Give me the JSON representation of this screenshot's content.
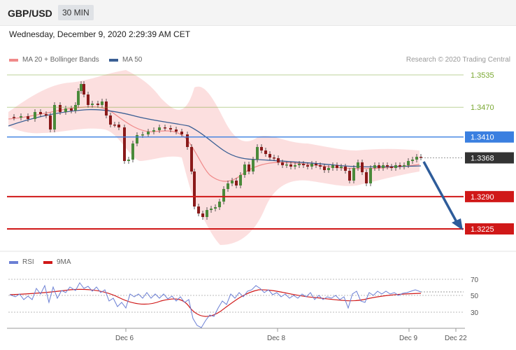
{
  "header": {
    "symbol": "GBP/USD",
    "timeframe": "30 MIN",
    "datetime": "Wednesday, December 9, 2020 2:29:39 AM CET"
  },
  "legend": {
    "ma20_label": "MA 20 + Bollinger Bands",
    "ma20_color": "#f08a8a",
    "ma50_label": "MA 50",
    "ma50_color": "#3a5f94"
  },
  "credit": "Research © 2020 Trading Central",
  "rsi_legend": {
    "rsi_label": "RSI",
    "rsi_color": "#6b7fd4",
    "ma9_label": "9MA",
    "ma9_color": "#d01818"
  },
  "chart_data": [
    {
      "type": "line",
      "title": "GBP/USD 30 MIN",
      "ylim": [
        1.32,
        1.356
      ],
      "levels": [
        {
          "value": 1.3535,
          "label": "1.3535",
          "color": "#7aa832",
          "style": "thin"
        },
        {
          "value": 1.347,
          "label": "1.3470",
          "color": "#7aa832",
          "style": "thin"
        },
        {
          "value": 1.341,
          "label": "1.3410",
          "color": "#3a7fe0",
          "style": "medium"
        },
        {
          "value": 1.3368,
          "label": "1.3368",
          "color": "#333333",
          "style": "dotted"
        },
        {
          "value": 1.329,
          "label": "1.3290",
          "color": "#d01818",
          "style": "thick"
        },
        {
          "value": 1.3225,
          "label": "1.3225",
          "color": "#d01818",
          "style": "thick"
        }
      ],
      "x_ticks": [
        "Dec 6",
        "Dec 8",
        "Dec 9",
        "Dec 22"
      ],
      "series": [
        {
          "name": "MA 20 + Bollinger Bands",
          "values": []
        },
        {
          "name": "MA 50",
          "values": []
        }
      ],
      "arrow": {
        "from": 1.3368,
        "to": 1.3225,
        "direction": "down",
        "color": "#2e5c9a"
      }
    },
    {
      "type": "line",
      "title": "RSI",
      "y_ticks": [
        70,
        50,
        30
      ],
      "series": [
        {
          "name": "RSI"
        },
        {
          "name": "9MA"
        }
      ]
    }
  ]
}
